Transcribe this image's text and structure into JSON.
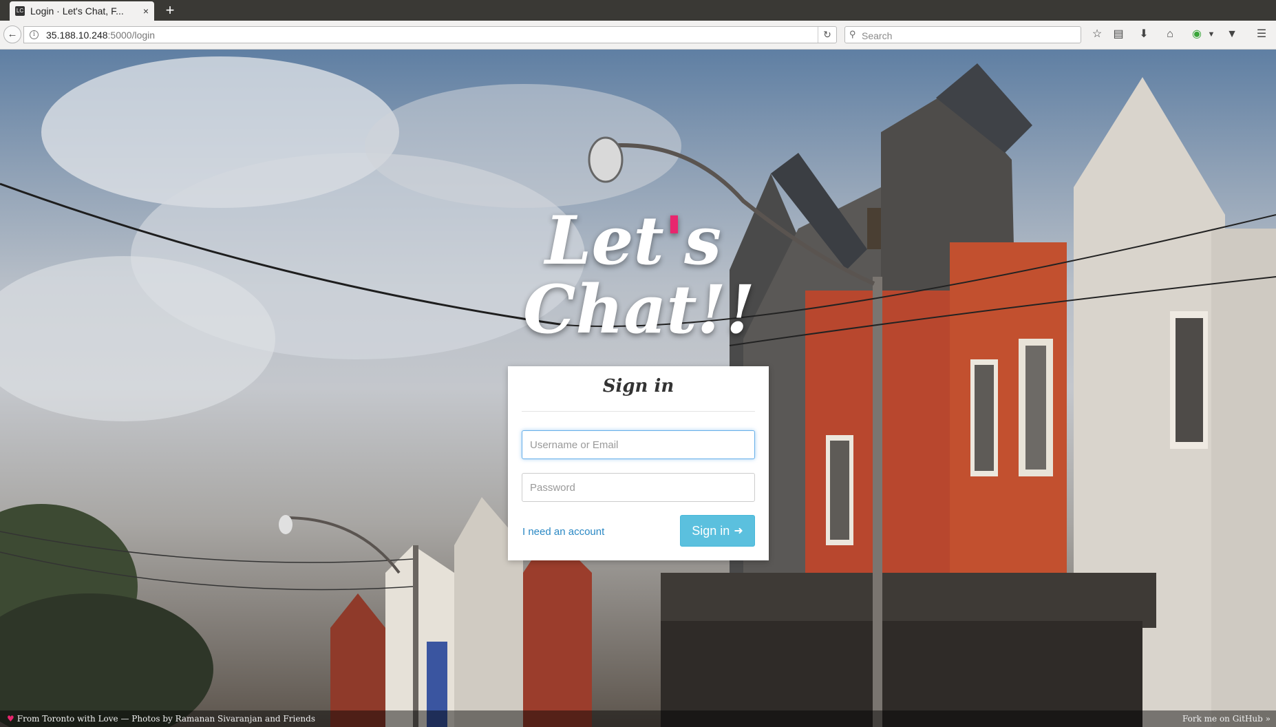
{
  "browser": {
    "tab_title": "Login · Let's Chat, F...",
    "tab_close": "×",
    "new_tab": "+",
    "url_host": "35.188.10.248",
    "url_path": ":5000/login",
    "search_placeholder": "Search",
    "icons": [
      "back-arrow-icon",
      "info-icon",
      "reload-icon",
      "search-icon",
      "bookmark-star-icon",
      "reading-list-icon",
      "download-icon",
      "home-icon",
      "extension-icon",
      "pocket-icon",
      "menu-icon"
    ]
  },
  "logo": {
    "line1_a": "Let",
    "line1_apostrophe": "'",
    "line1_b": "s",
    "line2": "Chat!!"
  },
  "login": {
    "title": "Sign in",
    "username_placeholder": "Username or Email",
    "password_placeholder": "Password",
    "account_link": "I need an account",
    "submit_label": "Sign in"
  },
  "footer": {
    "credit": "From Toronto with Love — Photos by Ramanan Sivaranjan and Friends",
    "github": "Fork me on GitHub »"
  },
  "colors": {
    "accent_pink": "#e8266e",
    "button_blue": "#5bc0de",
    "link_blue": "#2a88c4"
  }
}
